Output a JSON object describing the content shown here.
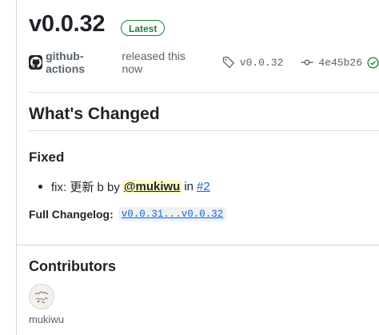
{
  "release": {
    "version": "v0.0.32",
    "badge": "Latest",
    "author": "github-actions",
    "released_text": "released this now",
    "tag": "v0.0.32",
    "commit": "4e45b26"
  },
  "body": {
    "heading": "What's Changed",
    "fixed_heading": "Fixed",
    "change": {
      "prefix": "fix: 更新 b by",
      "mention": "@mukiwu",
      "in_text": "in",
      "pr_link": "#2"
    },
    "full_changelog_label": "Full Changelog:",
    "compare_link": "v0.0.31...v0.0.32"
  },
  "contributors": {
    "heading": "Contributors",
    "users": [
      "mukiwu"
    ]
  },
  "colors": {
    "accent_green": "#1a7f37",
    "link_blue": "#0969da",
    "mention_bg": "#fff8c5",
    "border": "#d0d7de"
  },
  "icons": [
    "github-mark-icon",
    "tag-icon",
    "commit-icon",
    "check-circle-icon",
    "user-avatar"
  ]
}
